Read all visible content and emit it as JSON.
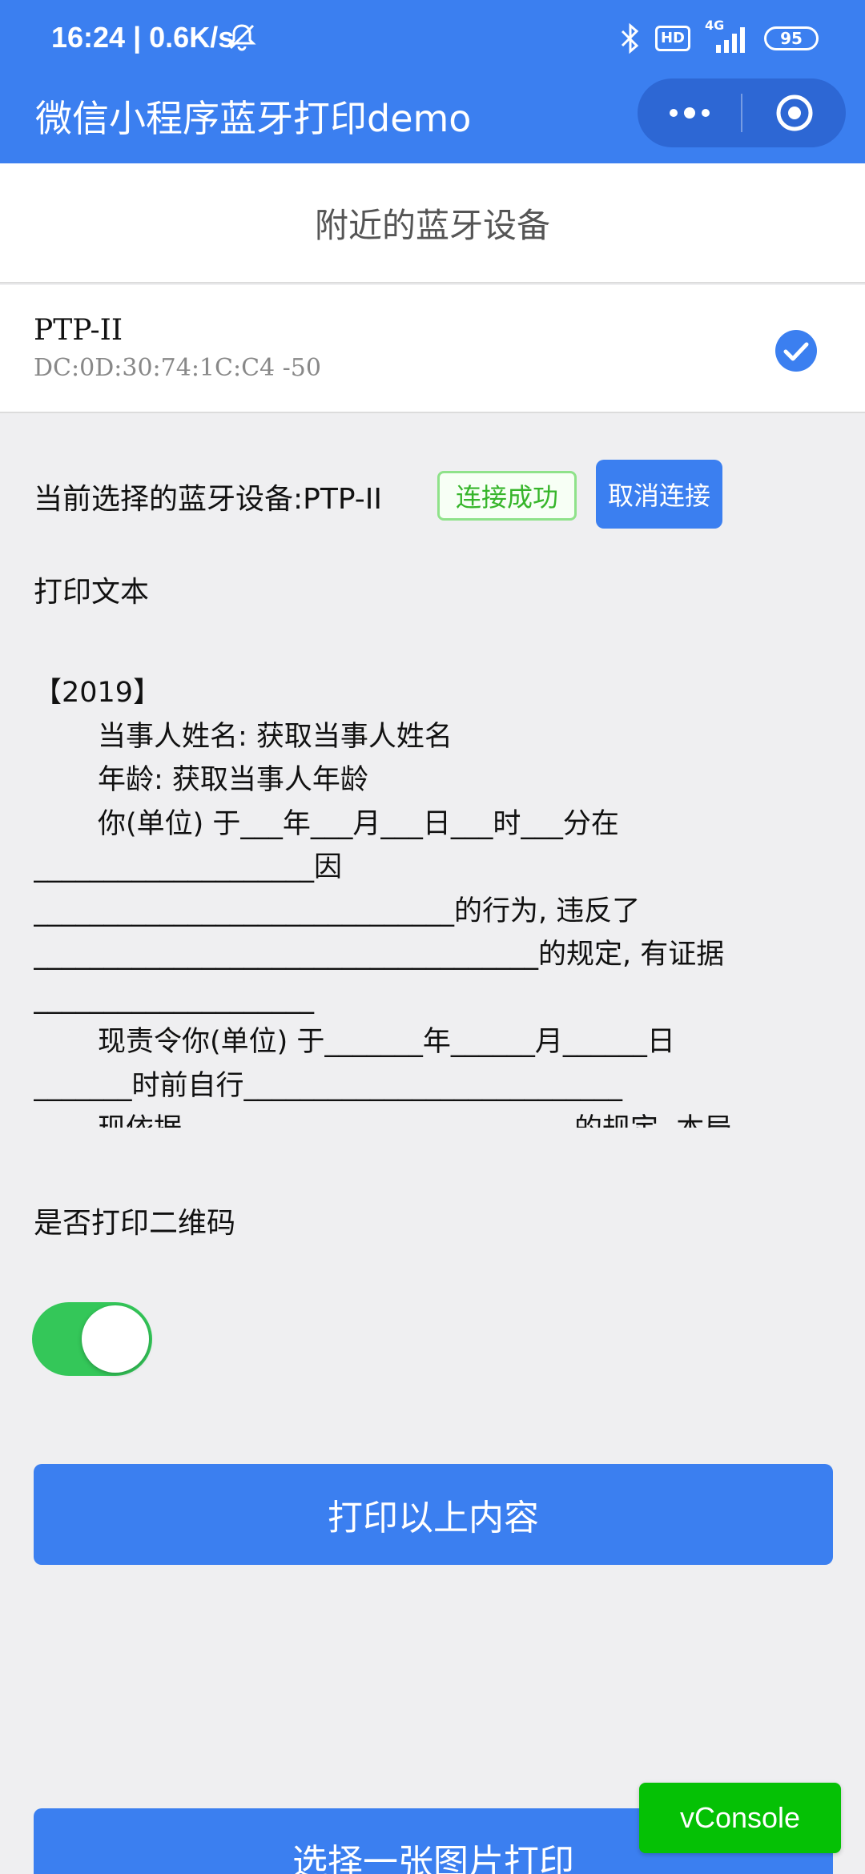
{
  "status_bar": {
    "time": "16:24 | 0.6K/s",
    "hd": "HD",
    "network": "4G",
    "battery": "95"
  },
  "nav": {
    "title": "微信小程序蓝牙打印demo"
  },
  "section_title": "附近的蓝牙设备",
  "device": {
    "name": "PTP-II",
    "address": "DC:0D:30:74:1C:C4 -50"
  },
  "current": {
    "label": "当前选择的蓝牙设备:PTP-II",
    "status": "连接成功",
    "disconnect": "取消连接"
  },
  "print_text_label": "打印文本",
  "print_text_lines": [
    "【2019】",
    "当事人姓名: 获取当事人姓名",
    "年龄: 获取当事人年龄",
    "你(单位) 于___年___月___日___时___分在",
    "____________________因",
    "______________________________的行为, 违反了",
    "____________________________________的规定, 有证据",
    "____________________",
    "现责令你(单位) 于_______年______月______日",
    "_______时前自行___________________________",
    "现依据____________________________的规定, 本局"
  ],
  "qr_label": "是否打印二维码",
  "qr_toggle_on": true,
  "print_button": "打印以上内容",
  "image_button": "选择一张图片打印",
  "vconsole": "vConsole",
  "colors": {
    "brand": "#3b7ff0",
    "success": "#36b52a",
    "toggle": "#34c759",
    "vconsole": "#05c105"
  }
}
